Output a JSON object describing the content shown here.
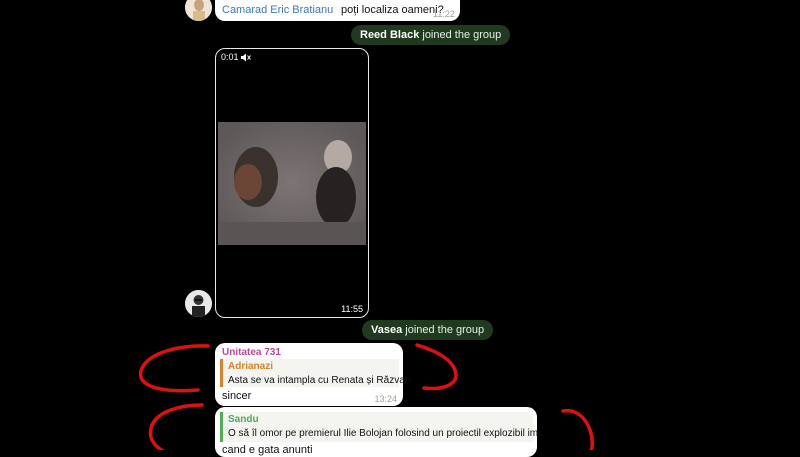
{
  "messages": {
    "top": {
      "sender": "Camarad Eric Bratianu",
      "text": "poți localiza oameni?",
      "time": "11:22"
    },
    "join1": {
      "user": "Reed Black",
      "action": "joined the group"
    },
    "video": {
      "elapsed": "0:01",
      "time": "11:55"
    },
    "join2": {
      "user": "Vasea",
      "action": "joined the group"
    },
    "reply1": {
      "sender": "Unitatea 731",
      "quote_author": "Adrianazi",
      "quote_text": "Asta se va intampla cu Renata și Răzvan",
      "text": "sincer",
      "time": "13:24"
    },
    "reply2": {
      "quote_author": "Sandu",
      "quote_text": "O să îl omor pe premierul Ilie Bolojan folosind un proiectil explozibil im...",
      "text": "cand e gata anunti"
    }
  },
  "colors": {
    "background": "#000000",
    "service_bg": "#1f3a1f",
    "sender_link": "#3a79b8",
    "unitatea": "#c0479a",
    "adrianazi": "#d9822b",
    "sandu": "#4caf50",
    "annotation_red": "#e01010"
  },
  "icons": {
    "mute": "speaker-muted-icon"
  }
}
